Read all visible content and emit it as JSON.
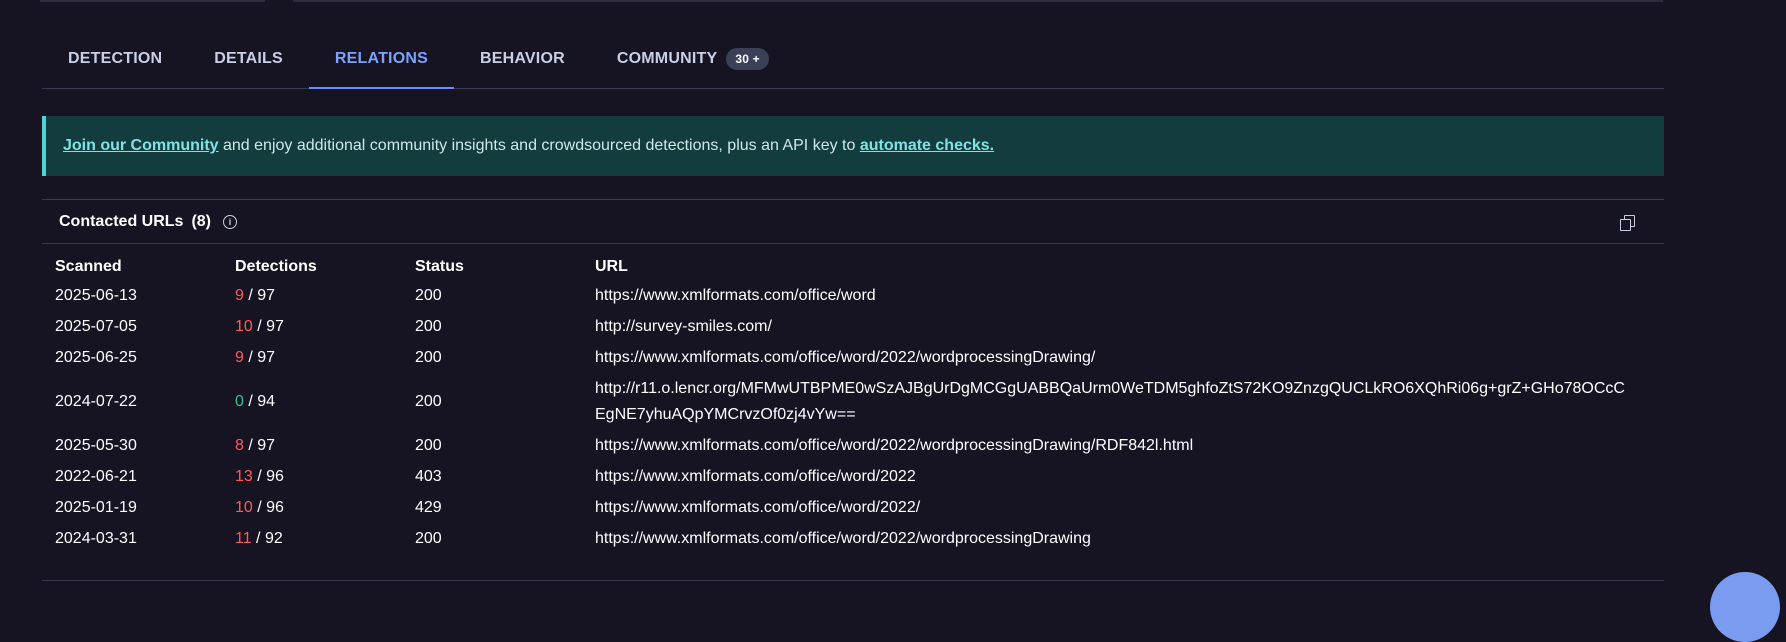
{
  "tabs": [
    {
      "label": "DETECTION",
      "active": false
    },
    {
      "label": "DETAILS",
      "active": false
    },
    {
      "label": "RELATIONS",
      "active": true
    },
    {
      "label": "BEHAVIOR",
      "active": false
    },
    {
      "label": "COMMUNITY",
      "active": false,
      "badge": "30 +"
    }
  ],
  "banner": {
    "join_link": "Join our Community",
    "text": " and enjoy additional community insights and crowdsourced detections, plus an API key to ",
    "automate_link": "automate checks."
  },
  "section": {
    "title": "Contacted URLs",
    "count": "(8)"
  },
  "table": {
    "headers": [
      "Scanned",
      "Detections",
      "Status",
      "URL"
    ],
    "rows": [
      {
        "scanned": "2025-06-13",
        "detections": "9",
        "total": " / 97",
        "status": "200",
        "url": "https://www.xmlformats.com/office/word"
      },
      {
        "scanned": "2025-07-05",
        "detections": "10",
        "total": " / 97",
        "status": "200",
        "url": "http://survey-smiles.com/"
      },
      {
        "scanned": "2025-06-25",
        "detections": "9",
        "total": " / 97",
        "status": "200",
        "url": "https://www.xmlformats.com/office/word/2022/wordprocessingDrawing/"
      },
      {
        "scanned": "2024-07-22",
        "detections": "0",
        "total": " / 94",
        "status": "200",
        "url": "http://r11.o.lencr.org/MFMwUTBPME0wSzAJBgUrDgMCGgUABBQaUrm0WeTDM5ghfoZtS72KO9ZnzgQUCLkRO6XQhRi06g+grZ+GHo78OCcCEgNE7yhuAQpYMCrvzOf0zj4vYw=="
      },
      {
        "scanned": "2025-05-30",
        "detections": "8",
        "total": " / 97",
        "status": "200",
        "url": "https://www.xmlformats.com/office/word/2022/wordprocessingDrawing/RDF842l.html"
      },
      {
        "scanned": "2022-06-21",
        "detections": "13",
        "total": " / 96",
        "status": "403",
        "url": "https://www.xmlformats.com/office/word/2022"
      },
      {
        "scanned": "2025-01-19",
        "detections": "10",
        "total": " / 96",
        "status": "429",
        "url": "https://www.xmlformats.com/office/word/2022/"
      },
      {
        "scanned": "2024-03-31",
        "detections": "11",
        "total": " / 92",
        "status": "200",
        "url": "https://www.xmlformats.com/office/word/2022/wordprocessingDrawing"
      }
    ]
  },
  "icons": {
    "info": "info-icon",
    "copy": "copy-icon"
  },
  "colors": {
    "background": "#161422",
    "active_tab": "#7aa3ff",
    "detection_positive": "#ff5a5a",
    "detection_zero": "#3fbf8f",
    "banner_bg": "#133c3e",
    "banner_accent": "#4fd3d1"
  }
}
